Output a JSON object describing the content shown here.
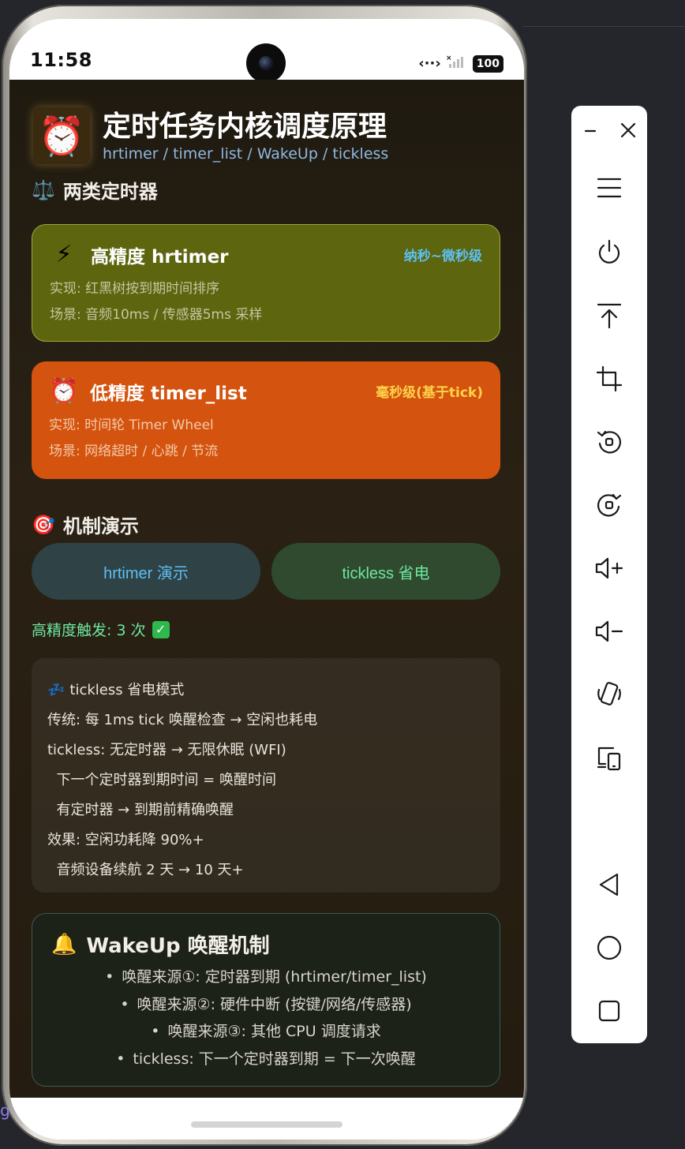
{
  "status_bar": {
    "time": "11:58",
    "battery": "100"
  },
  "header": {
    "icon": "alarm-clock-icon",
    "title": "定时任务内核调度原理",
    "subtitle": "hrtimer / timer_list / WakeUp / tickless"
  },
  "section_timers": {
    "icon": "balance-scale-icon",
    "title": "两类定时器"
  },
  "card_hrtimer": {
    "icon": "lightning-icon",
    "title": "高精度 hrtimer",
    "badge": "纳秒~微秒级",
    "lines": [
      "实现: 红黑树按到期时间排序",
      "场景: 音频10ms / 传感器5ms 采样"
    ]
  },
  "card_timerlist": {
    "icon": "alarm-clock-icon",
    "title": "低精度 timer_list",
    "badge": "毫秒级(基于tick)",
    "lines": [
      "实现: 时间轮 Timer Wheel",
      "场景: 网络超时 / 心跳 / 节流"
    ]
  },
  "section_demo": {
    "icon": "target-icon",
    "title": "机制演示"
  },
  "buttons": {
    "hrtimer": "hrtimer 演示",
    "tickless": "tickless 省电"
  },
  "trigger_status": "高精度触发: 3 次",
  "tickless_panel": {
    "icon": "sleep-icon",
    "lines": [
      "tickless 省电模式",
      "传统: 每 1ms tick 唤醒检查 → 空闲也耗电",
      "tickless: 无定时器 → 无限休眠 (WFI)",
      "  下一个定时器到期时间 = 唤醒时间",
      "  有定时器 → 到期前精确唤醒",
      "效果: 空闲功耗降 90%+",
      "  音频设备续航 2 天 → 10 天+"
    ]
  },
  "wakeup_card": {
    "icon": "bell-icon",
    "title": "WakeUp 唤醒机制",
    "items": [
      "唤醒来源①: 定时器到期 (hrtimer/timer_list)",
      "唤醒来源②: 硬件中断 (按键/网络/传感器)",
      "唤醒来源③: 其他 CPU 调度请求",
      "tickless: 下一个定时器到期 = 下一次唤醒"
    ]
  },
  "colors": {
    "screen_bg": "#241c10",
    "hrtimer_card": "#5e650f",
    "timerlist_card": "#d4530f",
    "accent_blue": "#5cc0f2",
    "accent_green": "#6ee6a0",
    "accent_yellow": "#ffd24a"
  },
  "toolbar": {
    "buttons": [
      "minimize-icon",
      "close-icon",
      "menu-icon",
      "power-icon",
      "pin-top-icon",
      "crop-icon",
      "rotate-left-icon",
      "rotate-right-icon",
      "volume-up-icon",
      "volume-down-icon",
      "shake-icon",
      "device-switch-icon",
      "back-icon",
      "home-icon",
      "overview-icon"
    ]
  }
}
